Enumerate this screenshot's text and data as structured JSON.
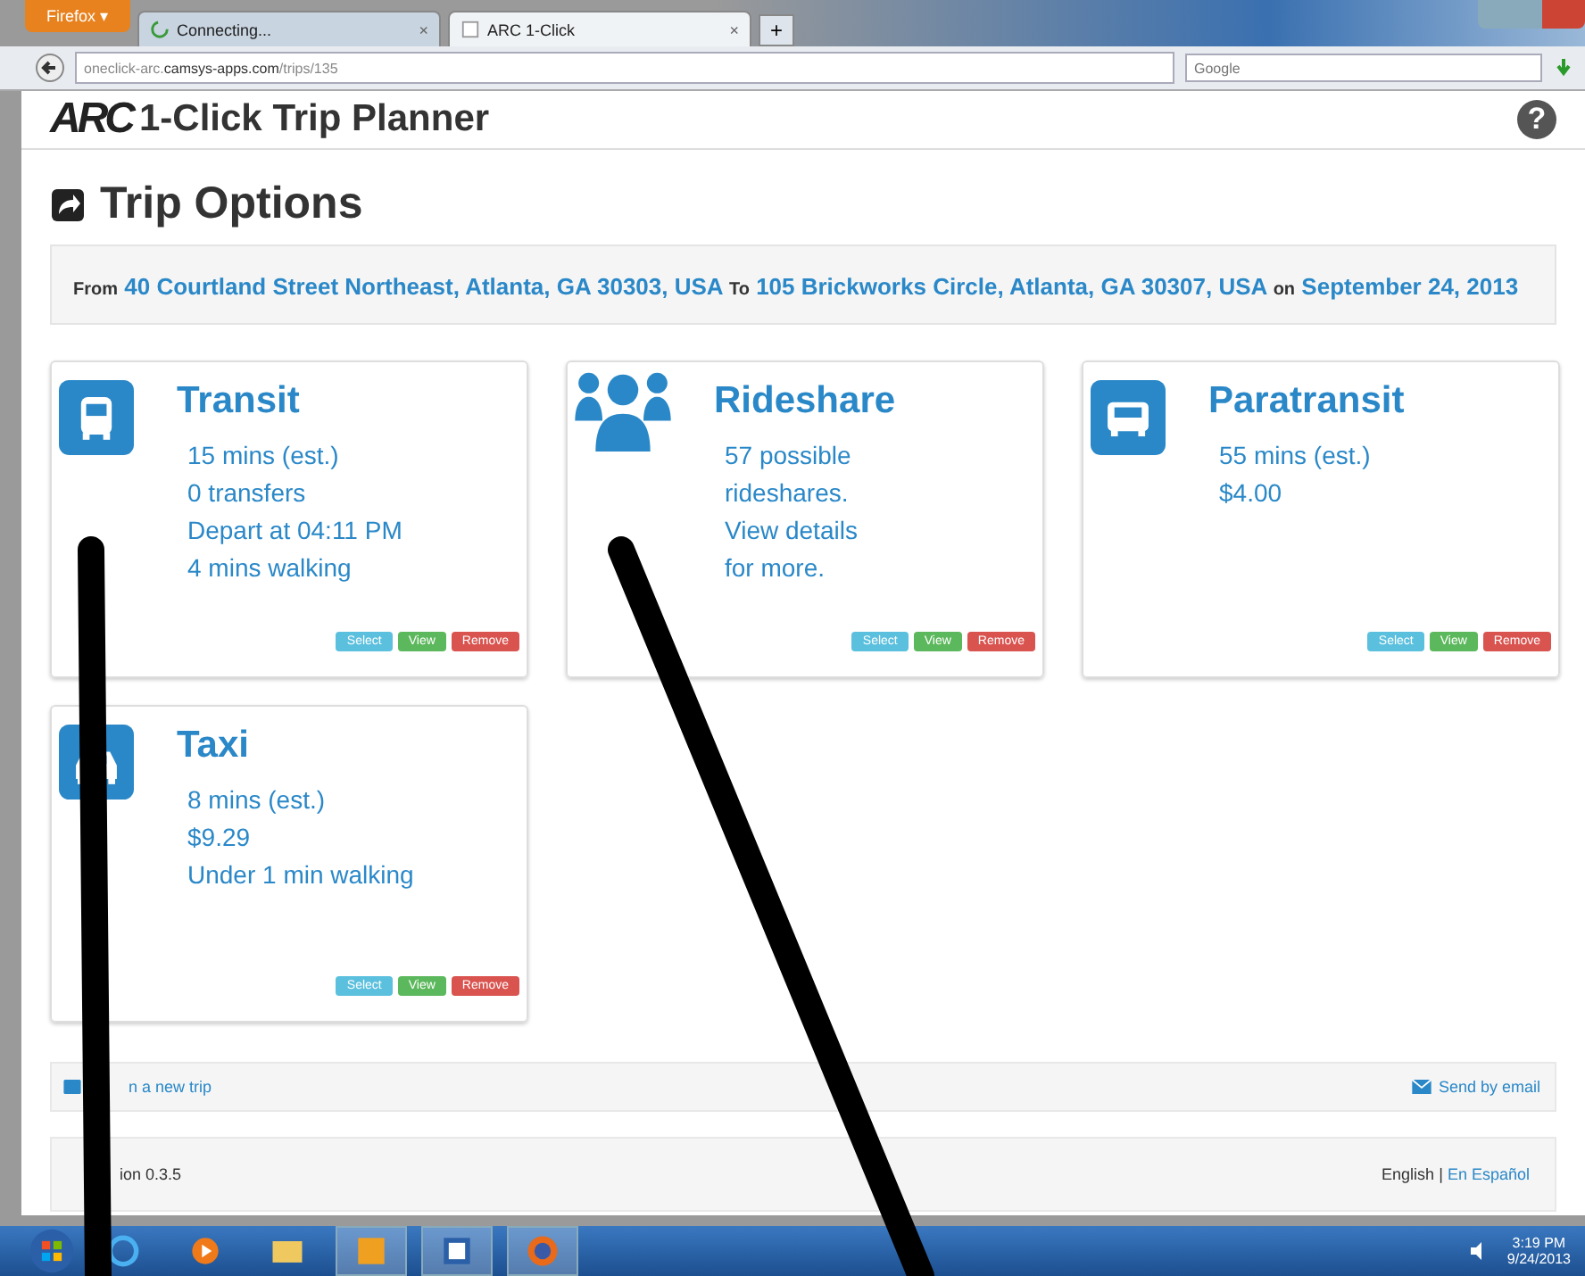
{
  "browser": {
    "menu_button": "Firefox ▾",
    "tabs": [
      {
        "label": "Connecting...",
        "selected": false,
        "loading": true,
        "close": "×"
      },
      {
        "label": "ARC 1-Click",
        "selected": true,
        "loading": false,
        "close": "×"
      }
    ],
    "new_tab": "+",
    "url_host": "oneclick-arc.",
    "url_domain": "camsys-apps.com",
    "url_path": "/trips/135",
    "search_placeholder": "Google"
  },
  "header": {
    "logo": "ARC",
    "title": "1-Click Trip Planner",
    "help": "?"
  },
  "page_title": "Trip Options",
  "route": {
    "from_label": "From",
    "from": "40 Courtland Street Northeast, Atlanta, GA 30303, USA",
    "to_label": "To",
    "to": "105 Brickworks Circle, Atlanta, GA 30307, USA",
    "on_label": "on",
    "date": "September 24, 2013"
  },
  "options": [
    {
      "kind": "transit",
      "title": "Transit",
      "details": [
        "15 mins (est.)",
        "0 transfers",
        "Depart at 04:11 PM",
        "4 mins walking"
      ],
      "buttons": [
        "Select",
        "View",
        "Remove"
      ]
    },
    {
      "kind": "rideshare",
      "title": "Rideshare",
      "details": [
        "57 possible",
        "rideshares.",
        "View details",
        "for more."
      ],
      "buttons": [
        "Select",
        "View",
        "Remove"
      ]
    },
    {
      "kind": "paratransit",
      "title": "Paratransit",
      "details": [
        "55 mins (est.)",
        "$4.00"
      ],
      "buttons": [
        "Select",
        "View",
        "Remove"
      ]
    },
    {
      "kind": "taxi",
      "title": "Taxi",
      "details": [
        "8 mins (est.)",
        "$9.29",
        "Under 1 min walking"
      ],
      "buttons": [
        "Select",
        "View",
        "Remove"
      ]
    }
  ],
  "actions": {
    "new_trip": "n a new trip",
    "email": "Send by email"
  },
  "footer": {
    "version": "ion 0.3.5",
    "language_current": "English",
    "separator": "|",
    "language_other": "En Español"
  },
  "taskbar": {
    "time": "3:19 PM",
    "date": "9/24/2013"
  }
}
